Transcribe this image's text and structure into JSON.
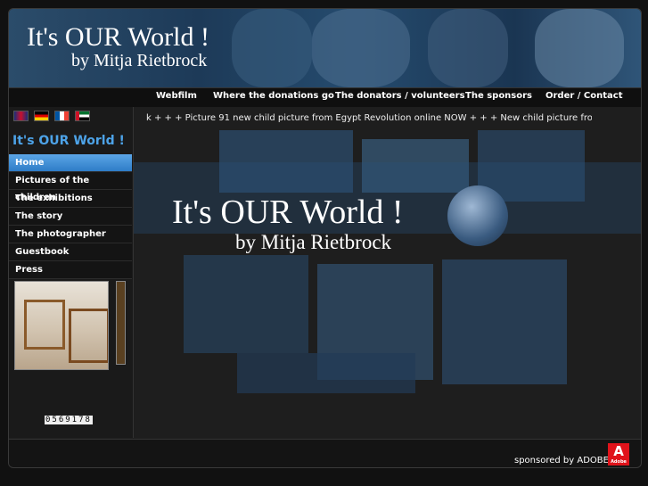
{
  "banner": {
    "title": "It's OUR World !",
    "subtitle": "by Mitja Rietbrock"
  },
  "nav": [
    {
      "label": "Webfilm"
    },
    {
      "label": "Where the donations go"
    },
    {
      "label": "The donators / volunteers"
    },
    {
      "label": "The sponsors"
    },
    {
      "label": "Order / Contact"
    }
  ],
  "languages": [
    {
      "icon": "uk-flag-icon"
    },
    {
      "icon": "germany-flag-icon"
    },
    {
      "icon": "france-flag-icon"
    },
    {
      "icon": "uae-flag-icon"
    }
  ],
  "sidebar": {
    "title": "It's OUR World !",
    "menu": [
      {
        "label": "Home"
      },
      {
        "label": "Pictures of the children"
      },
      {
        "label": "The exhibitions"
      },
      {
        "label": "The story"
      },
      {
        "label": "The photographer"
      },
      {
        "label": "Guestbook"
      },
      {
        "label": "Press"
      }
    ],
    "counter": "0569178"
  },
  "ticker": "k + + + Picture 91 new child picture from Egypt Revolution online NOW + + + New child picture from Libya online",
  "hero": {
    "title": "It's OUR World !",
    "subtitle": "by Mitja Rietbrock"
  },
  "footer": {
    "sponsor_text": "sponsored by ADOBE",
    "logo_letter": "A",
    "logo_word": "Adobe"
  },
  "colors": {
    "accent": "#4da3e8",
    "active_menu": "#3d8fd8",
    "adobe_red": "#e0131b"
  }
}
